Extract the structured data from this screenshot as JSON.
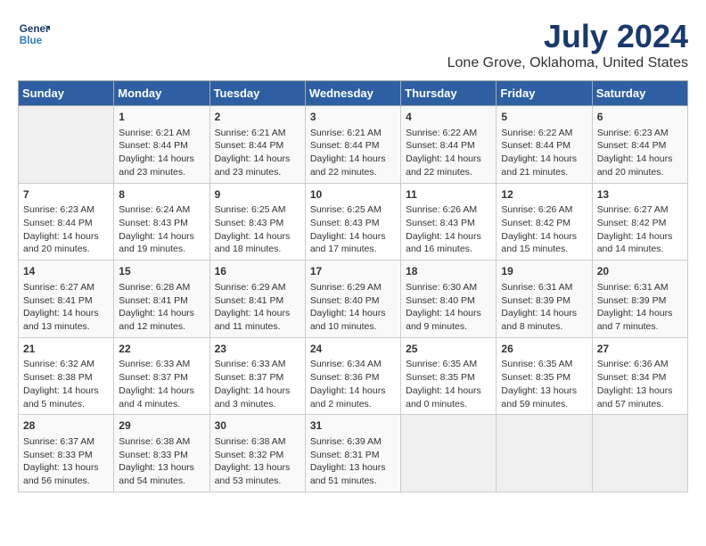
{
  "header": {
    "logo_line1": "General",
    "logo_line2": "Blue",
    "title": "July 2024",
    "subtitle": "Lone Grove, Oklahoma, United States"
  },
  "weekdays": [
    "Sunday",
    "Monday",
    "Tuesday",
    "Wednesday",
    "Thursday",
    "Friday",
    "Saturday"
  ],
  "weeks": [
    [
      {
        "day": "",
        "info": ""
      },
      {
        "day": "1",
        "info": "Sunrise: 6:21 AM\nSunset: 8:44 PM\nDaylight: 14 hours\nand 23 minutes."
      },
      {
        "day": "2",
        "info": "Sunrise: 6:21 AM\nSunset: 8:44 PM\nDaylight: 14 hours\nand 23 minutes."
      },
      {
        "day": "3",
        "info": "Sunrise: 6:21 AM\nSunset: 8:44 PM\nDaylight: 14 hours\nand 22 minutes."
      },
      {
        "day": "4",
        "info": "Sunrise: 6:22 AM\nSunset: 8:44 PM\nDaylight: 14 hours\nand 22 minutes."
      },
      {
        "day": "5",
        "info": "Sunrise: 6:22 AM\nSunset: 8:44 PM\nDaylight: 14 hours\nand 21 minutes."
      },
      {
        "day": "6",
        "info": "Sunrise: 6:23 AM\nSunset: 8:44 PM\nDaylight: 14 hours\nand 20 minutes."
      }
    ],
    [
      {
        "day": "7",
        "info": "Sunrise: 6:23 AM\nSunset: 8:44 PM\nDaylight: 14 hours\nand 20 minutes."
      },
      {
        "day": "8",
        "info": "Sunrise: 6:24 AM\nSunset: 8:43 PM\nDaylight: 14 hours\nand 19 minutes."
      },
      {
        "day": "9",
        "info": "Sunrise: 6:25 AM\nSunset: 8:43 PM\nDaylight: 14 hours\nand 18 minutes."
      },
      {
        "day": "10",
        "info": "Sunrise: 6:25 AM\nSunset: 8:43 PM\nDaylight: 14 hours\nand 17 minutes."
      },
      {
        "day": "11",
        "info": "Sunrise: 6:26 AM\nSunset: 8:43 PM\nDaylight: 14 hours\nand 16 minutes."
      },
      {
        "day": "12",
        "info": "Sunrise: 6:26 AM\nSunset: 8:42 PM\nDaylight: 14 hours\nand 15 minutes."
      },
      {
        "day": "13",
        "info": "Sunrise: 6:27 AM\nSunset: 8:42 PM\nDaylight: 14 hours\nand 14 minutes."
      }
    ],
    [
      {
        "day": "14",
        "info": "Sunrise: 6:27 AM\nSunset: 8:41 PM\nDaylight: 14 hours\nand 13 minutes."
      },
      {
        "day": "15",
        "info": "Sunrise: 6:28 AM\nSunset: 8:41 PM\nDaylight: 14 hours\nand 12 minutes."
      },
      {
        "day": "16",
        "info": "Sunrise: 6:29 AM\nSunset: 8:41 PM\nDaylight: 14 hours\nand 11 minutes."
      },
      {
        "day": "17",
        "info": "Sunrise: 6:29 AM\nSunset: 8:40 PM\nDaylight: 14 hours\nand 10 minutes."
      },
      {
        "day": "18",
        "info": "Sunrise: 6:30 AM\nSunset: 8:40 PM\nDaylight: 14 hours\nand 9 minutes."
      },
      {
        "day": "19",
        "info": "Sunrise: 6:31 AM\nSunset: 8:39 PM\nDaylight: 14 hours\nand 8 minutes."
      },
      {
        "day": "20",
        "info": "Sunrise: 6:31 AM\nSunset: 8:39 PM\nDaylight: 14 hours\nand 7 minutes."
      }
    ],
    [
      {
        "day": "21",
        "info": "Sunrise: 6:32 AM\nSunset: 8:38 PM\nDaylight: 14 hours\nand 5 minutes."
      },
      {
        "day": "22",
        "info": "Sunrise: 6:33 AM\nSunset: 8:37 PM\nDaylight: 14 hours\nand 4 minutes."
      },
      {
        "day": "23",
        "info": "Sunrise: 6:33 AM\nSunset: 8:37 PM\nDaylight: 14 hours\nand 3 minutes."
      },
      {
        "day": "24",
        "info": "Sunrise: 6:34 AM\nSunset: 8:36 PM\nDaylight: 14 hours\nand 2 minutes."
      },
      {
        "day": "25",
        "info": "Sunrise: 6:35 AM\nSunset: 8:35 PM\nDaylight: 14 hours\nand 0 minutes."
      },
      {
        "day": "26",
        "info": "Sunrise: 6:35 AM\nSunset: 8:35 PM\nDaylight: 13 hours\nand 59 minutes."
      },
      {
        "day": "27",
        "info": "Sunrise: 6:36 AM\nSunset: 8:34 PM\nDaylight: 13 hours\nand 57 minutes."
      }
    ],
    [
      {
        "day": "28",
        "info": "Sunrise: 6:37 AM\nSunset: 8:33 PM\nDaylight: 13 hours\nand 56 minutes."
      },
      {
        "day": "29",
        "info": "Sunrise: 6:38 AM\nSunset: 8:33 PM\nDaylight: 13 hours\nand 54 minutes."
      },
      {
        "day": "30",
        "info": "Sunrise: 6:38 AM\nSunset: 8:32 PM\nDaylight: 13 hours\nand 53 minutes."
      },
      {
        "day": "31",
        "info": "Sunrise: 6:39 AM\nSunset: 8:31 PM\nDaylight: 13 hours\nand 51 minutes."
      },
      {
        "day": "",
        "info": ""
      },
      {
        "day": "",
        "info": ""
      },
      {
        "day": "",
        "info": ""
      }
    ]
  ]
}
